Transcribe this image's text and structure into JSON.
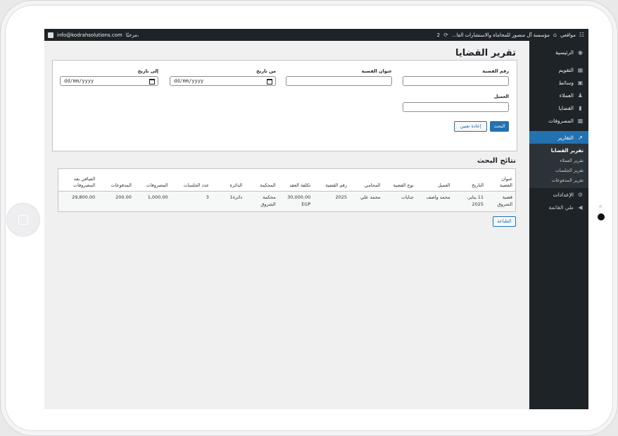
{
  "admin_bar": {
    "sites_label": "مواقعي",
    "site_name": "مؤسسة آل منصور للمحاماة والاستشارات القا...",
    "updates_count": "2",
    "greeting": "مرحبًا،",
    "user_email": "info@kodrahsolutions.com"
  },
  "sidebar": {
    "items": [
      {
        "label": "الرئيسية",
        "icon": "dashboard-icon"
      },
      {
        "label": "التقويم",
        "icon": "calendar-icon"
      },
      {
        "label": "وسائط",
        "icon": "media-icon"
      },
      {
        "label": "العملاء",
        "icon": "users-icon"
      },
      {
        "label": "القضايا",
        "icon": "folder-icon"
      },
      {
        "label": "المصروفات",
        "icon": "expenses-icon"
      },
      {
        "label": "التقارير",
        "icon": "chart-icon"
      },
      {
        "label": "الإعدادات",
        "icon": "gear-icon"
      },
      {
        "label": "طي القائمة",
        "icon": "collapse-icon"
      }
    ],
    "submenu": [
      "تقرير القضايا",
      "تقرير العملاء",
      "تقرير الجلسات",
      "تقرير المدفوعات"
    ]
  },
  "page": {
    "title": "تقرير القضايا",
    "filters": {
      "case_number_label": "رقم القضية",
      "case_title_label": "عنوان القضية",
      "from_date_label": "من تاريخ",
      "to_date_label": "إلى تاريخ",
      "client_label": "العميل",
      "from_date_value": "dd/mm/yyyy",
      "to_date_value": "dd/mm/yyyy",
      "search_button": "البحث",
      "reset_button": "إعادة تعيين"
    },
    "results_title": "نتائج البحث",
    "table": {
      "headers": [
        "عنوان القضية",
        "التاريخ",
        "العميل",
        "نوع القضية",
        "المحامي",
        "رقم القضية",
        "تكلفة العقد",
        "المحكمة",
        "الدائرة",
        "عدد الجلسات",
        "المصروفات",
        "المدفوعات",
        "الصافي بعد المصروفات"
      ],
      "rows": [
        [
          "قضية الشروق",
          "11 يناير، 2025",
          "محمد واصف",
          "جنايات",
          "محمد علي",
          "2025",
          "30,000.00 EGP",
          "محكمة الشروق",
          "دائرة1",
          "3",
          "1,000.00",
          "200.00",
          "29,800.00"
        ]
      ]
    },
    "print_button": "الطباعة"
  },
  "colors": {
    "accent": "#2271b1",
    "sidebar_bg": "#1d2327",
    "content_bg": "#f0f0f1"
  }
}
